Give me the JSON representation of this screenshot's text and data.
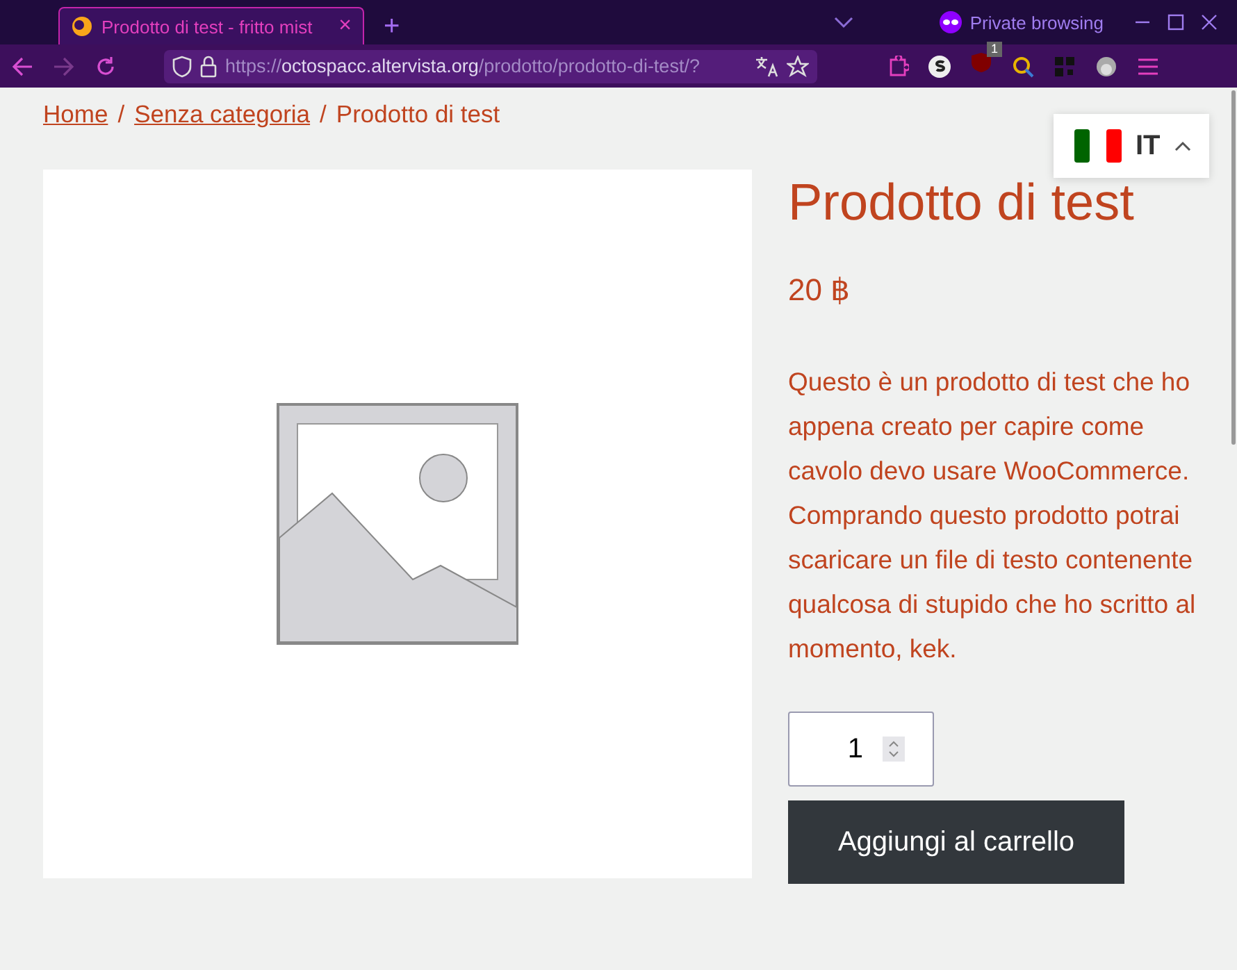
{
  "browser": {
    "tab": {
      "title": "Prodotto di test - fritto mist",
      "close": "×",
      "selected": true
    },
    "new_tab": "+",
    "private_label": "Private browsing",
    "url": {
      "scheme": "https://",
      "host": "octospacc.altervista.org",
      "path": "/prodotto/prodotto-di-test/?"
    },
    "extension_badge": "1"
  },
  "breadcrumb": {
    "separator": "/",
    "items": [
      {
        "kind": "link",
        "label": "Home"
      },
      {
        "kind": "link",
        "label": "Senza categoria"
      },
      {
        "kind": "current",
        "label": "Prodotto di test"
      }
    ]
  },
  "language": {
    "code": "IT",
    "expanded": false
  },
  "product": {
    "title": "Prodotto di test",
    "price": "20 ฿",
    "description": "Questo è un prodotto di test che ho appena creato per capire come cavolo devo usare WooCommerce. Comprando questo prodotto potrai scaricare un file di testo contenente qualcosa di stupido che ho scritto al momento, kek.",
    "quantity": "1",
    "add_button": "Aggiungi al carrello"
  }
}
